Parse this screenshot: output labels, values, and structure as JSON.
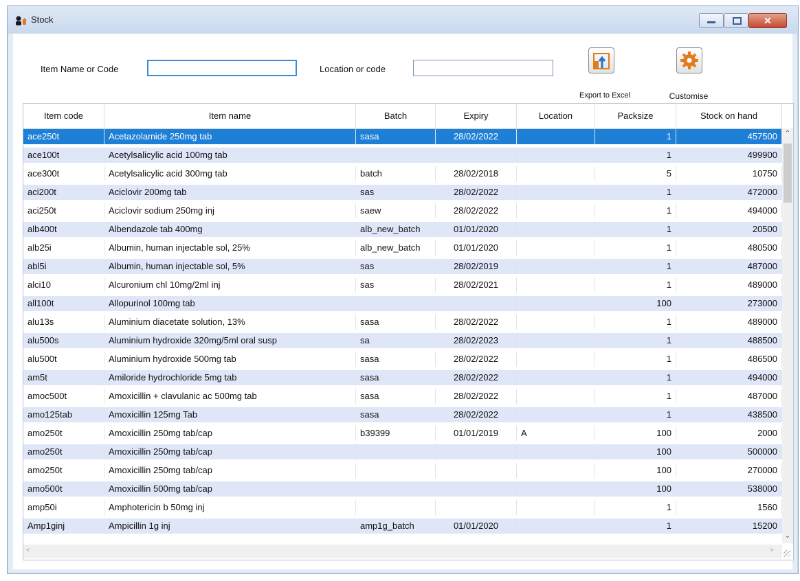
{
  "window": {
    "title": "Stock",
    "close_glyph": "✕"
  },
  "filters": {
    "item_label": "Item Name or Code",
    "item_value": "",
    "location_label": "Location or code",
    "location_value": ""
  },
  "toolbar": {
    "export_label": "Export to Excel",
    "customise_label": "Customise"
  },
  "colors": {
    "selection": "#1e7fd6",
    "alt_row": "#dfe6f7",
    "accent_orange": "#e07b1f"
  },
  "table": {
    "headers": [
      "Item code",
      "Item name",
      "Batch",
      "Expiry",
      "Location",
      "Packsize",
      "Stock on hand"
    ],
    "rows": [
      [
        "ace250t",
        "Acetazolamide 250mg tab",
        "sasa",
        "28/02/2022",
        "",
        "1",
        "457500"
      ],
      [
        "ace100t",
        "Acetylsalicylic acid 100mg  tab",
        "",
        "",
        "",
        "1",
        "499900"
      ],
      [
        "ace300t",
        "Acetylsalicylic acid 300mg tab",
        "batch",
        "28/02/2018",
        "",
        "5",
        "10750"
      ],
      [
        "aci200t",
        "Aciclovir 200mg tab",
        "sas",
        "28/02/2022",
        "",
        "1",
        "472000"
      ],
      [
        "aci250t",
        "Aciclovir sodium 250mg inj",
        "saew",
        "28/02/2022",
        "",
        "1",
        "494000"
      ],
      [
        "alb400t",
        "Albendazole tab 400mg",
        "alb_new_batch",
        "01/01/2020",
        "",
        "1",
        "20500"
      ],
      [
        "alb25i",
        "Albumin, human injectable sol, 25%",
        "alb_new_batch",
        "01/01/2020",
        "",
        "1",
        "480500"
      ],
      [
        "abl5i",
        "Albumin, human injectable sol, 5%",
        "sas",
        "28/02/2019",
        "",
        "1",
        "487000"
      ],
      [
        "alci10",
        "Alcuronium chl 10mg/2ml inj",
        "sas",
        "28/02/2021",
        "",
        "1",
        "489000"
      ],
      [
        "all100t",
        "Allopurinol 100mg tab",
        "",
        "",
        "",
        "100",
        "273000"
      ],
      [
        "alu13s",
        "Aluminium diacetate solution, 13%",
        "sasa",
        "28/02/2022",
        "",
        "1",
        "489000"
      ],
      [
        "alu500s",
        "Aluminium hydroxide 320mg/5ml oral susp",
        "sa",
        "28/02/2023",
        "",
        "1",
        "488500"
      ],
      [
        "alu500t",
        "Aluminium hydroxide 500mg tab",
        "sasa",
        "28/02/2022",
        "",
        "1",
        "486500"
      ],
      [
        "am5t",
        "Amiloride hydrochloride 5mg tab",
        "sasa",
        "28/02/2022",
        "",
        "1",
        "494000"
      ],
      [
        "amoc500t",
        "Amoxicillin + clavulanic ac 500mg tab",
        "sasa",
        "28/02/2022",
        "",
        "1",
        "487000"
      ],
      [
        "amo125tab",
        "Amoxicillin 125mg Tab",
        "sasa",
        "28/02/2022",
        "",
        "1",
        "438500"
      ],
      [
        "amo250t",
        "Amoxicillin 250mg tab/cap",
        "b39399",
        "01/01/2019",
        "A",
        "100",
        "2000"
      ],
      [
        "amo250t",
        "Amoxicillin 250mg tab/cap",
        "",
        "",
        "",
        "100",
        "500000"
      ],
      [
        "amo250t",
        "Amoxicillin 250mg tab/cap",
        "",
        "",
        "",
        "100",
        "270000"
      ],
      [
        "amo500t",
        "Amoxicillin 500mg tab/cap",
        "",
        "",
        "",
        "100",
        "538000"
      ],
      [
        "amp50i",
        "Amphotericin b 50mg inj",
        "",
        "",
        "",
        "1",
        "1560"
      ],
      [
        "Amp1ginj",
        "Ampicillin 1g inj",
        "amp1g_batch",
        "01/01/2020",
        "",
        "1",
        "15200"
      ]
    ],
    "selected_row": 0
  }
}
